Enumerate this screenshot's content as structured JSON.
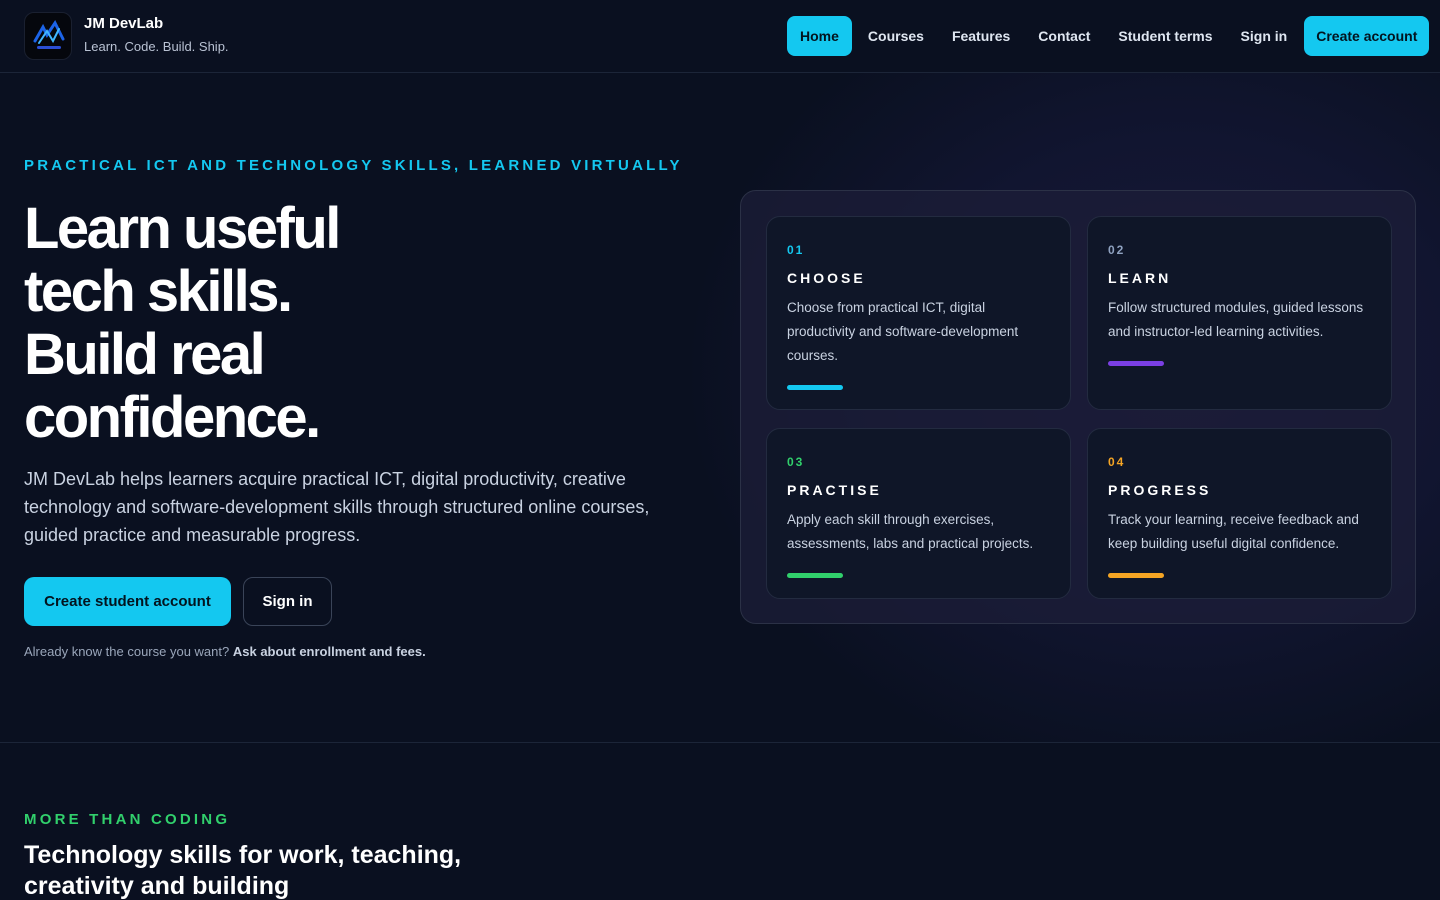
{
  "brand": {
    "name": "JM DevLab",
    "tagline": "Learn. Code. Build. Ship."
  },
  "nav": {
    "items": [
      "Home",
      "Courses",
      "Features",
      "Contact",
      "Student terms",
      "Sign in"
    ],
    "active": "Home",
    "cta": "Create account"
  },
  "hero": {
    "eyebrow": "PRACTICAL ICT AND TECHNOLOGY SKILLS, LEARNED VIRTUALLY",
    "title_lines": [
      "Learn useful",
      "tech skills.",
      "Build real",
      "confidence."
    ],
    "description": "JM DevLab helps learners acquire practical ICT, digital productivity, creative technology and software-development skills through structured online courses, guided practice and measurable progress.",
    "primary_button": "Create student account",
    "secondary_button": "Sign in",
    "note_text": "Already know the course you want?",
    "note_link": "Ask about enrollment and fees."
  },
  "steps": [
    {
      "number": "01",
      "title": "CHOOSE",
      "text": "Choose from practical ICT, digital productivity and software-development courses.",
      "color": "#14c8f0"
    },
    {
      "number": "02",
      "title": "LEARN",
      "text": "Follow structured modules, guided lessons and instructor-led learning activities.",
      "color": "#7b3fe4"
    },
    {
      "number": "03",
      "title": "PRACTISE",
      "text": "Apply each skill through exercises, assessments, labs and practical projects.",
      "color": "#31d06c"
    },
    {
      "number": "04",
      "title": "PROGRESS",
      "text": "Track your learning, receive feedback and keep building useful digital confidence.",
      "color": "#f5a524"
    }
  ],
  "section2": {
    "eyebrow": "MORE THAN CODING",
    "title": "Technology skills for work, teaching, creativity and building"
  },
  "colors": {
    "accent": "#14c8f0",
    "background": "#0a1020",
    "green": "#31d06c"
  }
}
